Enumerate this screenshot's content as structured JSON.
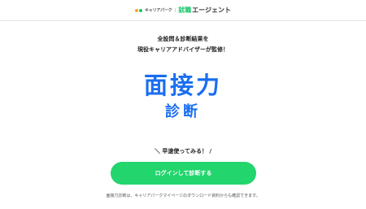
{
  "header": {
    "logo_sub": "キャリアパーク",
    "logo_sep": "|",
    "logo_brand_accent": "就職",
    "logo_brand": "エージェント"
  },
  "heading": {
    "line1": "全設問＆診断結果を",
    "line2": "現役キャリアアドバイザーが監修！"
  },
  "title": {
    "line1": "面接力",
    "line2": "診断"
  },
  "cta": {
    "lead": "＼ 早速使ってみる！ /",
    "button_label": "ログインして診断する"
  },
  "footer_note": "面接力診断は、キャリアパークマイページのダウンロード資料からも確認できます。",
  "colors": {
    "accent_blue": "#1a6ef0",
    "button_green": "#22d56d"
  }
}
